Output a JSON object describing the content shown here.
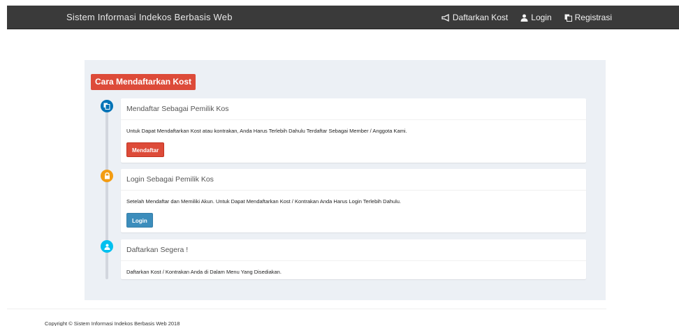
{
  "navbar": {
    "brand": "Sistem Informasi Indekos Berbasis Web",
    "links": [
      {
        "label": "Daftarkan Kost",
        "icon": "megaphone-icon"
      },
      {
        "label": "Login",
        "icon": "user-icon"
      },
      {
        "label": "Registrasi",
        "icon": "copy-icon"
      }
    ]
  },
  "main": {
    "heading": "Cara Mendaftarkan Kost",
    "steps": [
      {
        "title": "Mendaftar Sebagai Pemilik Kos",
        "text": "Untuk Dapat Mendaftarkan Kost atau kontrakan, Anda Harus Terlebih Dahulu Terdaftar Sebagai Member / Anggota Kami.",
        "button": "Mendaftar",
        "icon": "copy-icon",
        "icon_color": "#0073b7"
      },
      {
        "title": "Login Sebagai Pemilik Kos",
        "text": "Setelah Mendaftar dan Memiliki Akun. Untuk Dapat Mendaftarkan Kost / Kontrakan Anda Harus Login Terlebih Dahulu.",
        "button": "Login",
        "icon": "lock-icon",
        "icon_color": "#f39c12"
      },
      {
        "title": "Daftarkan Segera !",
        "text": "Daftarkan Kost / Kontrakan Anda di Dalam Menu Yang Disediakan.",
        "icon": "user-icon",
        "icon_color": "#00c0ef"
      }
    ]
  },
  "footer": {
    "copyright": "Copyright © Sistem Informasi Indekos Berbasis Web 2018"
  }
}
